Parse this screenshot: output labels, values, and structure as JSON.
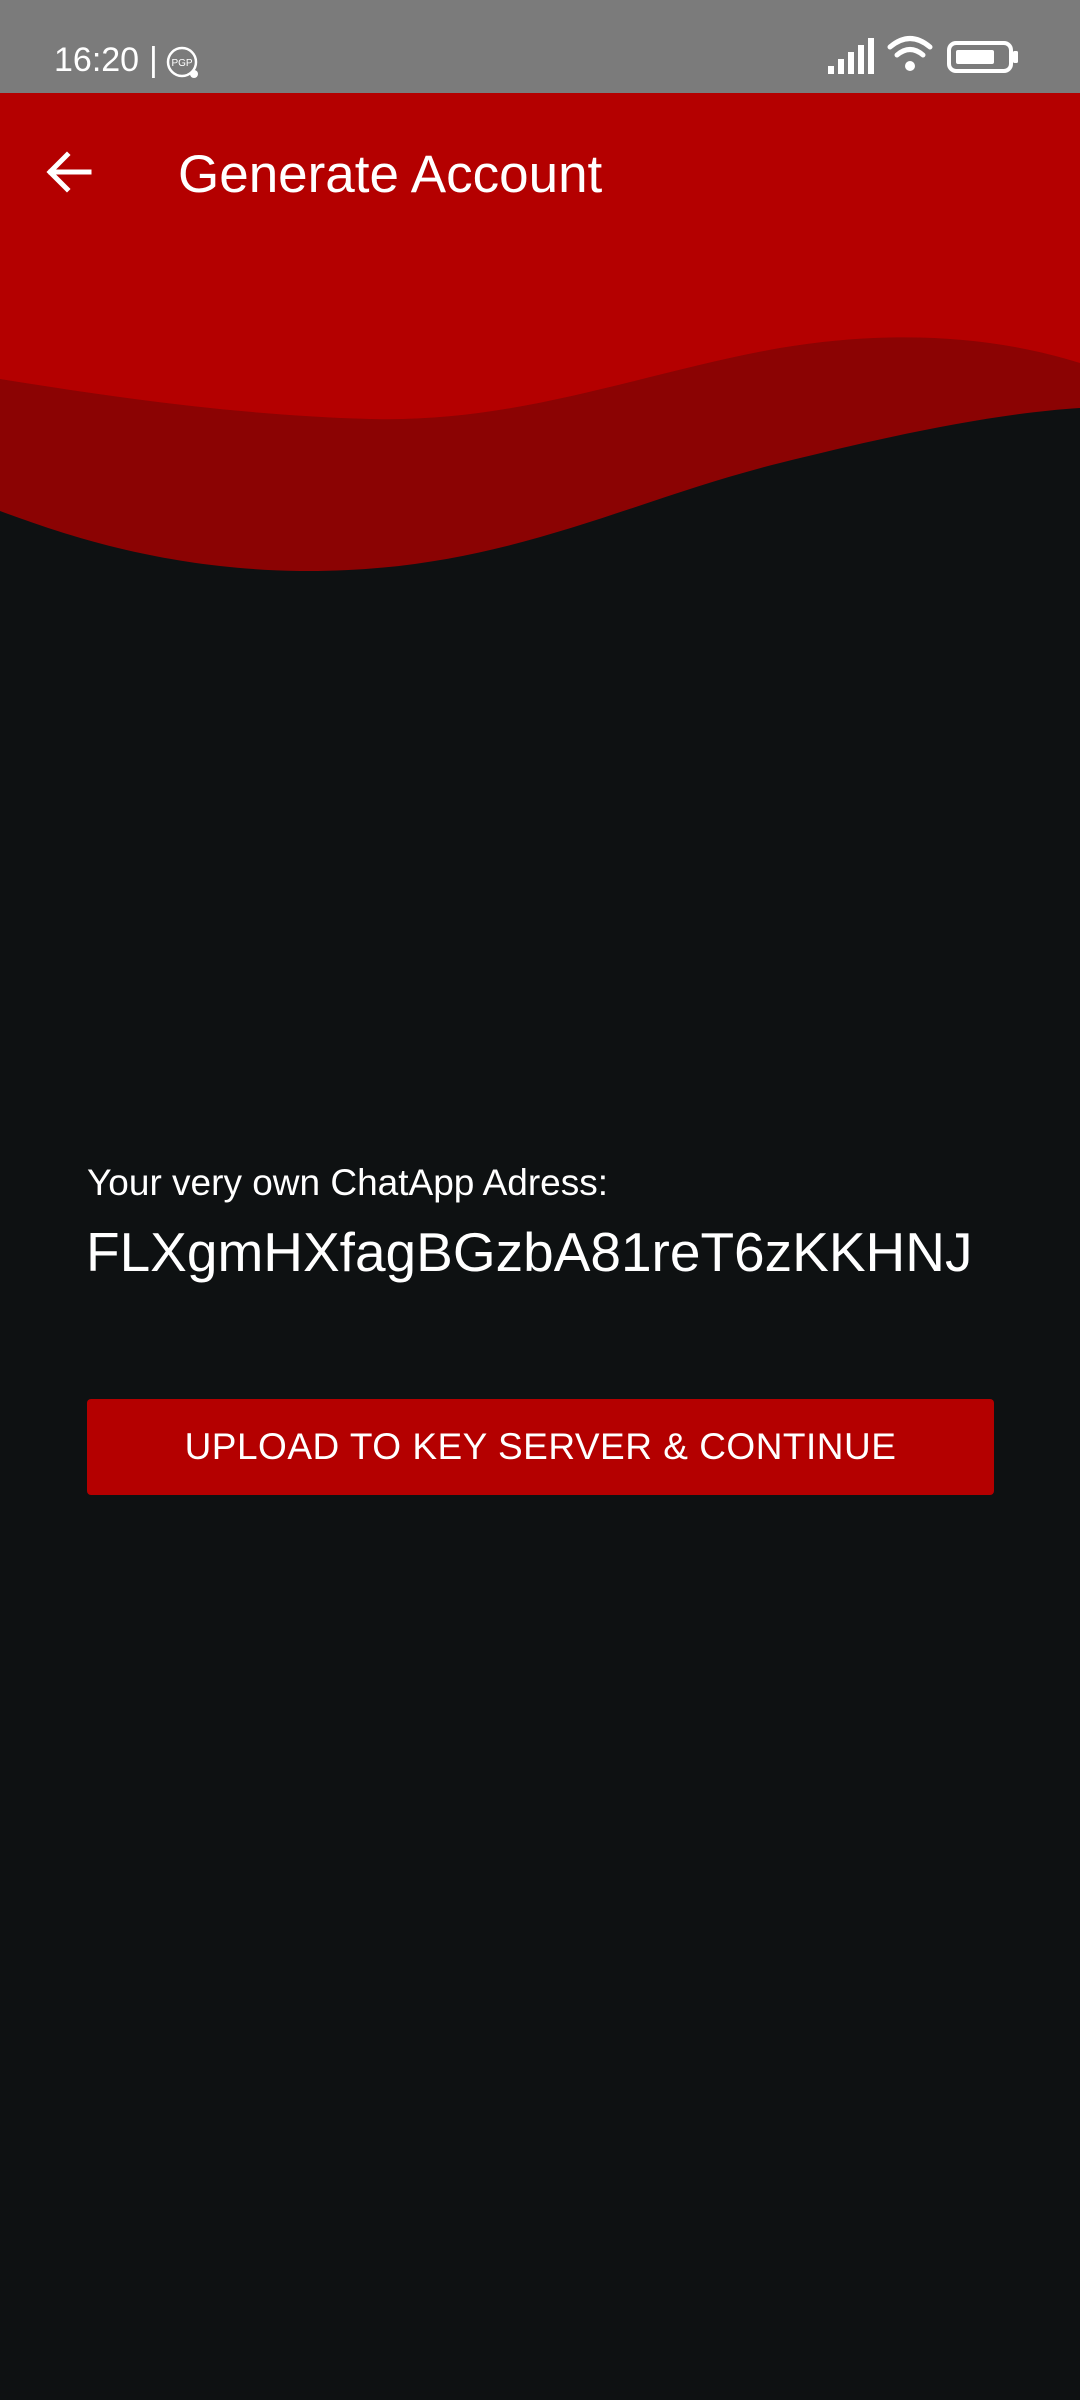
{
  "status_bar": {
    "time": "16:20",
    "separator": "|",
    "icons": [
      "pgp-icon",
      "signal-icon",
      "wifi-icon",
      "battery-icon"
    ]
  },
  "toolbar": {
    "title": "Generate Account",
    "back_icon": "arrow-left-icon"
  },
  "account": {
    "label": "Your very own ChatApp Adress:",
    "address": "FLXgmHXfagBGzbA81reT6zKKHNJ"
  },
  "actions": {
    "upload_label": "UPLOAD TO KEY SERVER & CONTINUE"
  },
  "colors": {
    "header_red": "#b40000",
    "wave_dark_red": "#8b0303",
    "background": "#0e1112",
    "status_bar": "#7b7b7b",
    "text": "#ffffff"
  }
}
